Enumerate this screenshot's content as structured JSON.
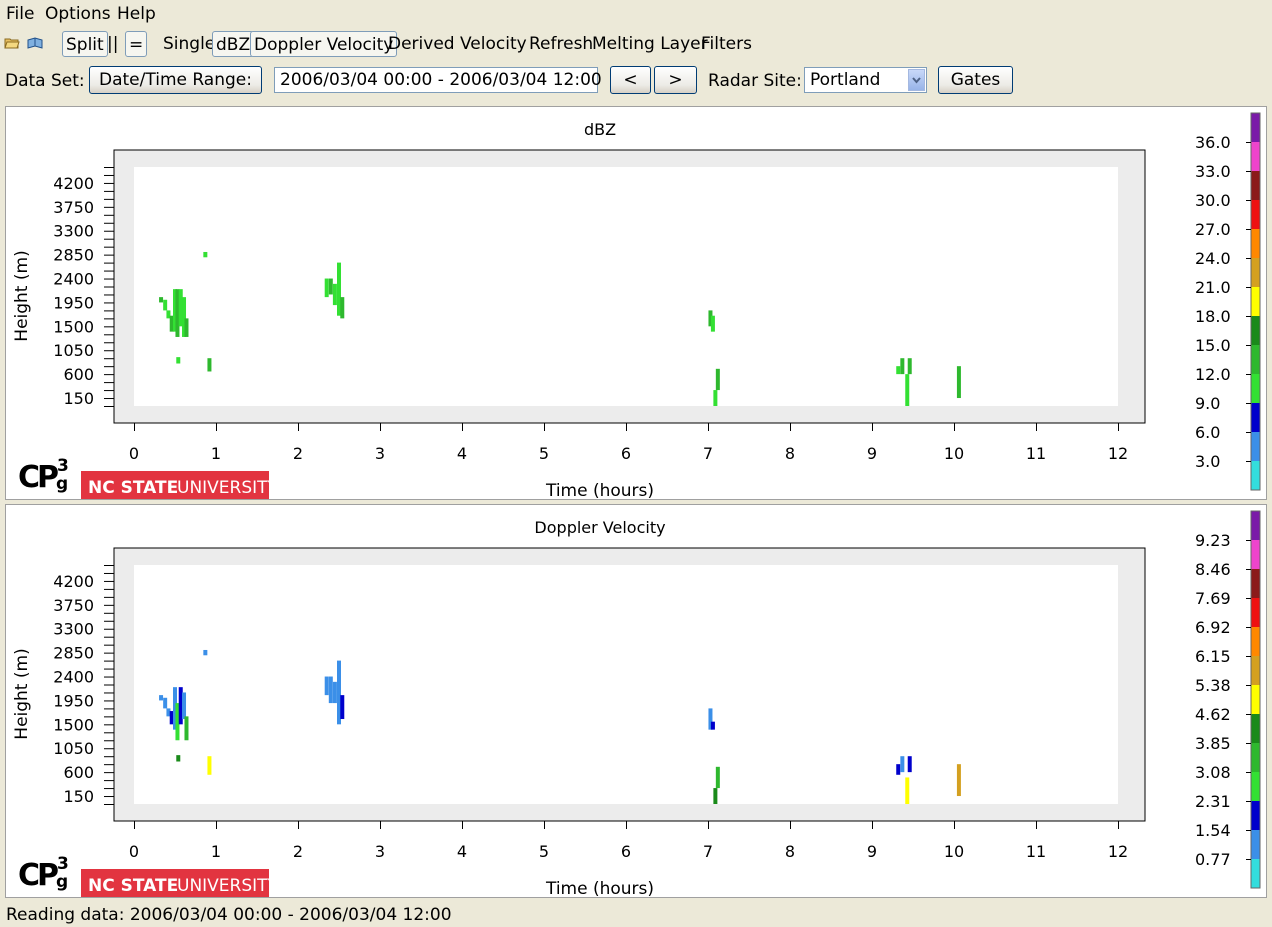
{
  "menu": {
    "file": "File",
    "options": "Options",
    "help": "Help"
  },
  "toolbar": {
    "split": "Split",
    "double_bar": "||",
    "equals": "=",
    "single": "Single",
    "dbz": "dBZ",
    "doppler_velocity": "Doppler Velocity",
    "derived_velocity": "Derived Velocity",
    "refresh": "Refresh",
    "melting_layer": "Melting Layer",
    "filters": "Filters"
  },
  "data_row": {
    "data_set_label": "Data Set:",
    "date_range_button": "Date/Time Range:",
    "date_range_value": "2006/03/04 00:00 - 2006/03/04 12:00",
    "prev_button": "<",
    "next_button": ">",
    "radar_site_label": "Radar Site:",
    "radar_site_value": "Portland",
    "gates_button": "Gates"
  },
  "logo": {
    "cp3g": "CP",
    "cp3g_sup": "3",
    "cp3g_sub": "g",
    "nc_state": "NC STATE",
    "university": "UNIVERSITY"
  },
  "status": "Reading data: 2006/03/04 00:00 - 2006/03/04 12:00",
  "chart_data": [
    {
      "type": "heatmap",
      "title": "dBZ",
      "xlabel": "Time (hours)",
      "ylabel": "Height (m)",
      "xlim": [
        0,
        12
      ],
      "ylim": [
        0,
        4500
      ],
      "x_ticks": [
        "0",
        "1",
        "2",
        "3",
        "4",
        "5",
        "6",
        "7",
        "8",
        "9",
        "10",
        "11",
        "12"
      ],
      "y_ticks": [
        "150",
        "600",
        "1050",
        "1500",
        "1950",
        "2400",
        "2850",
        "3300",
        "3750",
        "4200"
      ],
      "colorbar": {
        "labels": [
          "36.0",
          "33.0",
          "30.0",
          "27.0",
          "24.0",
          "21.0",
          "18.0",
          "15.0",
          "12.0",
          "9.0",
          "6.0",
          "3.0"
        ],
        "colors": [
          "#7a1aa8",
          "#ee44cc",
          "#8b1a1a",
          "#ee1111",
          "#ff8800",
          "#d4a020",
          "#ffff00",
          "#1a8a1a",
          "#2eb82e",
          "#33e033",
          "#0000cc",
          "#3b8fe8",
          "#33dddd"
        ]
      },
      "cells": [
        {
          "x": 0.33,
          "y0": 1950,
          "y1": 2050,
          "c": "#2eb82e"
        },
        {
          "x": 0.38,
          "y0": 1800,
          "y1": 2000,
          "c": "#33e033"
        },
        {
          "x": 0.42,
          "y0": 1650,
          "y1": 1800,
          "c": "#33e033"
        },
        {
          "x": 0.46,
          "y0": 1400,
          "y1": 1700,
          "c": "#2eb82e"
        },
        {
          "x": 0.5,
          "y0": 1400,
          "y1": 2200,
          "c": "#33e033"
        },
        {
          "x": 0.53,
          "y0": 1300,
          "y1": 2200,
          "c": "#2eb82e"
        },
        {
          "x": 0.57,
          "y0": 1500,
          "y1": 2200,
          "c": "#33e033"
        },
        {
          "x": 0.61,
          "y0": 1300,
          "y1": 2050,
          "c": "#33e033"
        },
        {
          "x": 0.64,
          "y0": 1300,
          "y1": 1650,
          "c": "#2eb82e"
        },
        {
          "x": 0.54,
          "y0": 800,
          "y1": 920,
          "c": "#33e033"
        },
        {
          "x": 0.87,
          "y0": 2800,
          "y1": 2900,
          "c": "#33e033"
        },
        {
          "x": 0.92,
          "y0": 650,
          "y1": 900,
          "c": "#2eb82e"
        },
        {
          "x": 2.35,
          "y0": 2050,
          "y1": 2400,
          "c": "#33e033"
        },
        {
          "x": 2.4,
          "y0": 2100,
          "y1": 2400,
          "c": "#2eb82e"
        },
        {
          "x": 2.45,
          "y0": 1900,
          "y1": 2300,
          "c": "#33e033"
        },
        {
          "x": 2.5,
          "y0": 1700,
          "y1": 2700,
          "c": "#33e033"
        },
        {
          "x": 2.54,
          "y0": 1650,
          "y1": 2050,
          "c": "#2eb82e"
        },
        {
          "x": 7.03,
          "y0": 1500,
          "y1": 1800,
          "c": "#2eb82e"
        },
        {
          "x": 7.06,
          "y0": 1400,
          "y1": 1700,
          "c": "#33e033"
        },
        {
          "x": 7.09,
          "y0": 0,
          "y1": 300,
          "c": "#33e033"
        },
        {
          "x": 7.12,
          "y0": 300,
          "y1": 700,
          "c": "#2eb82e"
        },
        {
          "x": 9.32,
          "y0": 600,
          "y1": 750,
          "c": "#33e033"
        },
        {
          "x": 9.37,
          "y0": 600,
          "y1": 900,
          "c": "#2eb82e"
        },
        {
          "x": 9.43,
          "y0": 0,
          "y1": 600,
          "c": "#33e033"
        },
        {
          "x": 9.46,
          "y0": 600,
          "y1": 900,
          "c": "#2eb82e"
        },
        {
          "x": 10.06,
          "y0": 150,
          "y1": 750,
          "c": "#2eb82e"
        }
      ]
    },
    {
      "type": "heatmap",
      "title": "Doppler Velocity",
      "xlabel": "Time (hours)",
      "ylabel": "Height (m)",
      "xlim": [
        0,
        12
      ],
      "ylim": [
        0,
        4500
      ],
      "x_ticks": [
        "0",
        "1",
        "2",
        "3",
        "4",
        "5",
        "6",
        "7",
        "8",
        "9",
        "10",
        "11",
        "12"
      ],
      "y_ticks": [
        "150",
        "600",
        "1050",
        "1500",
        "1950",
        "2400",
        "2850",
        "3300",
        "3750",
        "4200"
      ],
      "colorbar": {
        "labels": [
          "9.23",
          "8.46",
          "7.69",
          "6.92",
          "6.15",
          "5.38",
          "4.62",
          "3.85",
          "3.08",
          "2.31",
          "1.54",
          "0.77"
        ],
        "colors": [
          "#7a1aa8",
          "#ee44cc",
          "#8b1a1a",
          "#ee1111",
          "#ff8800",
          "#d4a020",
          "#ffff00",
          "#1a8a1a",
          "#2eb82e",
          "#33e033",
          "#0000cc",
          "#3b8fe8",
          "#33dddd"
        ]
      },
      "cells": [
        {
          "x": 0.33,
          "y0": 1950,
          "y1": 2050,
          "c": "#3b8fe8"
        },
        {
          "x": 0.38,
          "y0": 1800,
          "y1": 2000,
          "c": "#3b8fe8"
        },
        {
          "x": 0.42,
          "y0": 1650,
          "y1": 1800,
          "c": "#3b8fe8"
        },
        {
          "x": 0.46,
          "y0": 1500,
          "y1": 1750,
          "c": "#0000cc"
        },
        {
          "x": 0.5,
          "y0": 1400,
          "y1": 2200,
          "c": "#3b8fe8"
        },
        {
          "x": 0.53,
          "y0": 1200,
          "y1": 1900,
          "c": "#33e033"
        },
        {
          "x": 0.57,
          "y0": 1500,
          "y1": 2200,
          "c": "#0000cc"
        },
        {
          "x": 0.61,
          "y0": 1600,
          "y1": 2100,
          "c": "#3b8fe8"
        },
        {
          "x": 0.64,
          "y0": 1200,
          "y1": 1650,
          "c": "#2eb82e"
        },
        {
          "x": 0.54,
          "y0": 800,
          "y1": 920,
          "c": "#1a8a1a"
        },
        {
          "x": 0.87,
          "y0": 2800,
          "y1": 2900,
          "c": "#3b8fe8"
        },
        {
          "x": 0.92,
          "y0": 550,
          "y1": 900,
          "c": "#ffff00"
        },
        {
          "x": 2.35,
          "y0": 2050,
          "y1": 2400,
          "c": "#3b8fe8"
        },
        {
          "x": 2.4,
          "y0": 1900,
          "y1": 2400,
          "c": "#3b8fe8"
        },
        {
          "x": 2.45,
          "y0": 1900,
          "y1": 2300,
          "c": "#3b8fe8"
        },
        {
          "x": 2.5,
          "y0": 1500,
          "y1": 2700,
          "c": "#3b8fe8"
        },
        {
          "x": 2.54,
          "y0": 1600,
          "y1": 2050,
          "c": "#0000cc"
        },
        {
          "x": 7.03,
          "y0": 1400,
          "y1": 1800,
          "c": "#3b8fe8"
        },
        {
          "x": 7.06,
          "y0": 1400,
          "y1": 1550,
          "c": "#0000cc"
        },
        {
          "x": 7.09,
          "y0": 0,
          "y1": 300,
          "c": "#1a8a1a"
        },
        {
          "x": 7.12,
          "y0": 300,
          "y1": 700,
          "c": "#2eb82e"
        },
        {
          "x": 9.32,
          "y0": 550,
          "y1": 750,
          "c": "#0000cc"
        },
        {
          "x": 9.37,
          "y0": 600,
          "y1": 900,
          "c": "#3b8fe8"
        },
        {
          "x": 9.43,
          "y0": 0,
          "y1": 500,
          "c": "#ffff00"
        },
        {
          "x": 9.46,
          "y0": 600,
          "y1": 900,
          "c": "#0000cc"
        },
        {
          "x": 10.06,
          "y0": 150,
          "y1": 750,
          "c": "#d4a020"
        }
      ]
    }
  ]
}
